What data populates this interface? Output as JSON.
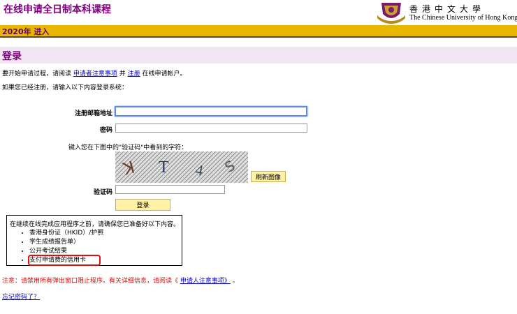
{
  "header": {
    "site_title": "在线申请全日制本科课程",
    "logo_cn": "香港中文大學",
    "logo_en": "The Chinese University of Hong Kong"
  },
  "year_bar": {
    "text": "2020年  进入"
  },
  "login": {
    "heading": "登录",
    "intro_before": "要开始申请过程，请阅读 ",
    "intro_link1": "申请者注意事项",
    "intro_mid": " 并 ",
    "intro_link2": "注册",
    "intro_after": " 在线申请帐户。",
    "registered_text": "如果您已经注册，请输入以下内容登录系统：",
    "email_label": "注册邮箱地址",
    "email_value": "",
    "password_label": "密码",
    "password_value": "",
    "captcha_prompt": "键入您在下图中的\"验证码\"中看到的字符：",
    "captcha_chars": "ꓘ T 4 ꓢ",
    "refresh_button": "刷新图像",
    "captcha_label": "验证码",
    "captcha_value": "",
    "login_button": "登录"
  },
  "checklist": {
    "intro": "在继续在线完成应用程序之前，请确保您已准备好以下内容。",
    "items": [
      "香港身份证（HKID）/护照",
      "学生成绩报告单）",
      "公开考试结果",
      "支付申请费的信用卡"
    ]
  },
  "warning": {
    "text": "注意：请禁用所有弹出窗口阻止程序。有关详细信息，请阅读《 ",
    "link": "申请人注意事项》",
    "after": " 。"
  },
  "forgot_link": "忘记密码了？",
  "colors": {
    "purple": "#800080",
    "year_bar": "#e8b800",
    "link": "#0000cc",
    "warning": "#d01010"
  }
}
